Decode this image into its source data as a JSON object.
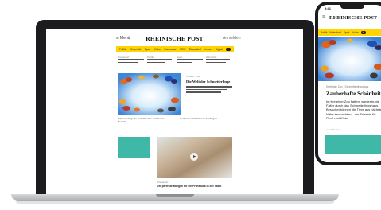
{
  "laptop": {
    "site": {
      "logo": "RHEINISCHE POST",
      "menu_label": "Menü",
      "account_label": "Anmelden",
      "nav_items": [
        "Politik",
        "Wirtschaft",
        "Sport",
        "Kultur",
        "Panorama",
        "NRW",
        "Düsseldorf",
        "Leben",
        "Digital",
        "Auto",
        "Reise",
        "Gesundheit",
        "Freizeit"
      ],
      "plus_badge": "+",
      "teasers": [
        {
          "kicker": "Düsseldorf"
        },
        {
          "kicker": "Politik"
        },
        {
          "kicker": "Sport"
        },
        {
          "kicker": "Wirtschaft"
        }
      ],
      "hero": {
        "kicker": "Krefeld · Zoo",
        "title": "Die Welt der Schmetterlinge"
      },
      "sub_teasers": [
        {
          "text": "Schmetterlinge im Krefelder Zoo: Ein bunter Besuch"
        },
        {
          "text": "Hochsaison für Falter in der Region"
        }
      ],
      "photo_story": {
        "kicker": "Düsseldorf",
        "title": "Der perfekte Morgen für ein Frühstück in der Stadt"
      }
    }
  },
  "phone": {
    "status_time": "9:41",
    "logo": "RHEINISCHE POST",
    "nav_items": [
      "Politik",
      "Wirtschaft",
      "Sport",
      "Kultur",
      "Panorama"
    ],
    "plus_badge": "+",
    "article": {
      "kicker": "Krefelder Zoo · Schmetterlingshaus",
      "title": "Zauberhafte Schönheiten",
      "body": "Im Krefelder Zoo flattern wieder bunte Falter durch das Schmetterlingshaus. Besucher können die Tiere aus nächster Nähe beobachten – ein Erlebnis für Groß und Klein.",
      "time": "vor 2 Stunden"
    }
  },
  "colors": {
    "brand_yellow": "#ffd400",
    "teal_block": "#3fb8a7",
    "device_dark": "#1c1c1e"
  }
}
